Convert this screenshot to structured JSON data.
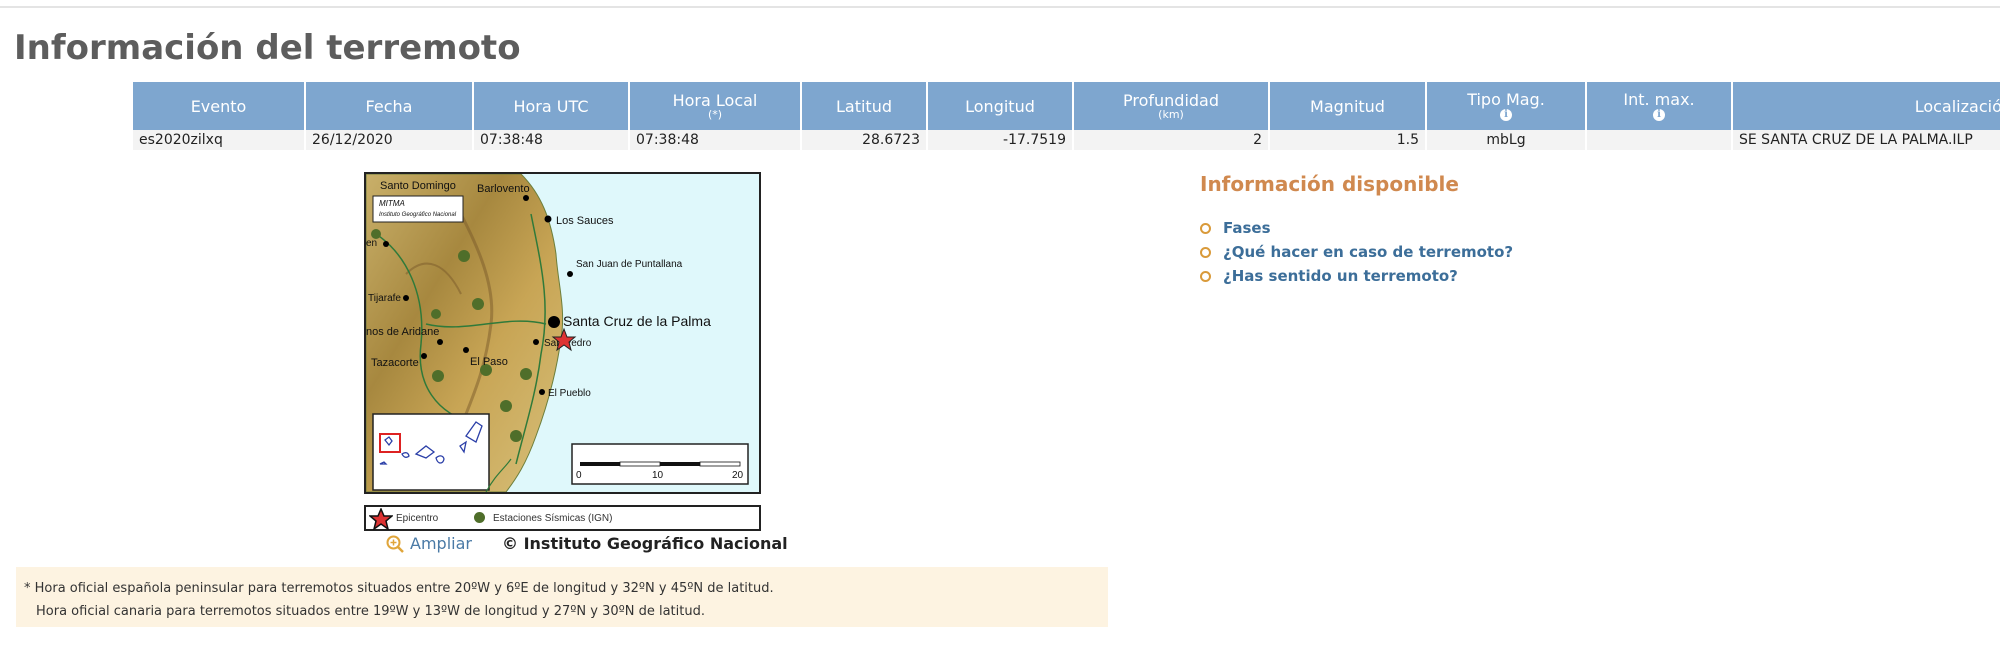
{
  "page": {
    "title": "Información del terremoto"
  },
  "table": {
    "headers": {
      "evento": "Evento",
      "fecha": "Fecha",
      "hora_utc": "Hora UTC",
      "hora_local": "Hora Local",
      "hora_local_sub": "(*)",
      "latitud": "Latitud",
      "longitud": "Longitud",
      "profundidad": "Profundidad",
      "profundidad_sub": "(km)",
      "magnitud": "Magnitud",
      "tipo_mag": "Tipo Mag.",
      "int_max": "Int. max.",
      "localizacion": "Localización"
    },
    "row": {
      "evento": "es2020zilxq",
      "fecha": "26/12/2020",
      "hora_utc": "07:38:48",
      "hora_local": "07:38:48",
      "latitud": "28.6723",
      "longitud": "-17.7519",
      "profundidad": "2",
      "magnitud": "1.5",
      "tipo_mag": "mbLg",
      "int_max": "",
      "localizacion": "SE SANTA CRUZ DE LA PALMA.ILP"
    }
  },
  "map": {
    "header_line1": "MITMA",
    "header_line2": "Instituto Geográfico Nacional",
    "places": {
      "santo_domingo": "Santo Domingo",
      "barlovento": "Barlovento",
      "los_sauces": "Los Sauces",
      "san_juan": "San Juan de Puntallana",
      "tijarafe": "Tijarafe",
      "santa_cruz": "Santa Cruz de la Palma",
      "san_pedro": "San Pedro",
      "los_llanos": "nos de Aridane",
      "tazacorte": "Tazacorte",
      "el_paso": "El Paso",
      "el_pueblo": "El Pueblo",
      "garafia": "en"
    },
    "scale": {
      "t0": "0",
      "t10": "10",
      "t20": "20"
    }
  },
  "legend": {
    "epicentro": "Epicentro",
    "estaciones": "Estaciones Sísmicas (IGN)"
  },
  "ampliar": "Ampliar",
  "copyright": "© Instituto Geográfico Nacional",
  "note": {
    "line1": "* Hora oficial española peninsular para terremotos situados entre 20ºW y 6ºE de longitud y 32ºN y 45ºN de latitud.",
    "line2": "Hora oficial canaria para terremotos situados entre 19ºW y 13ºW de longitud y 27ºN y 30ºN de latitud."
  },
  "available": {
    "title": "Información disponible",
    "items": [
      "Fases",
      "¿Qué hacer en caso de terremoto?",
      "¿Has sentido un terremoto?"
    ]
  },
  "colors": {
    "header_bg": "#7ea6cf",
    "accent_orange": "#d0894f",
    "link_blue": "#3c6e99",
    "note_bg": "#fdf3e1"
  }
}
